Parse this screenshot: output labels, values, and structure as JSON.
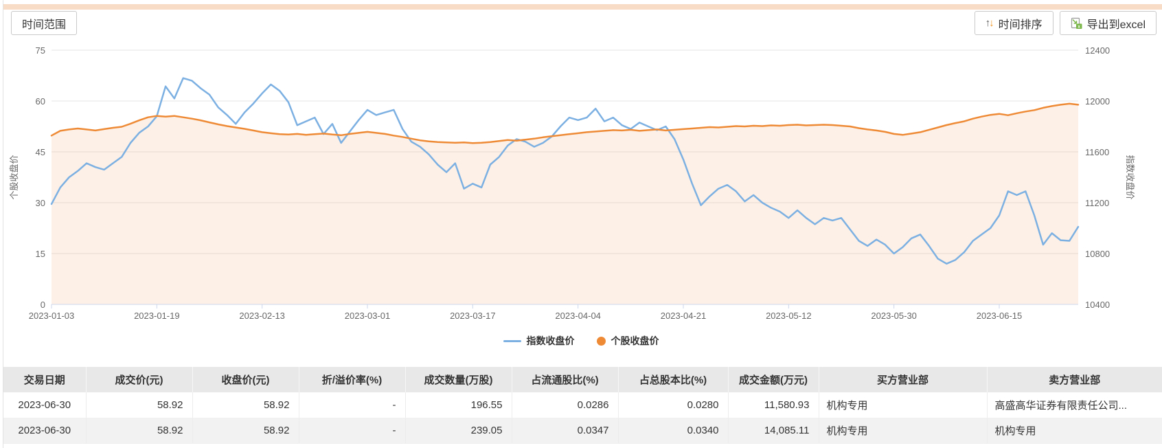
{
  "toolbar": {
    "time_range_label": "时间范围",
    "time_sort_label": "时间排序",
    "export_label": "导出到excel"
  },
  "colors": {
    "top_strip": "#f9dcc6",
    "index_line": "#7cb0e2",
    "stock_line": "#ee8a36",
    "area_fill": "rgba(238,150,70,0.13)",
    "grid": "#e6e6e6",
    "axis_line": "#ccd6eb",
    "axis_text": "#666666"
  },
  "chart_data": {
    "type": "line",
    "x_tick_every": 12,
    "x": [
      "2023-01-03",
      "2023-01-04",
      "2023-01-05",
      "2023-01-06",
      "2023-01-09",
      "2023-01-10",
      "2023-01-11",
      "2023-01-12",
      "2023-01-13",
      "2023-01-16",
      "2023-01-17",
      "2023-01-18",
      "2023-01-19",
      "2023-01-20",
      "2023-01-30",
      "2023-01-31",
      "2023-02-01",
      "2023-02-02",
      "2023-02-03",
      "2023-02-06",
      "2023-02-07",
      "2023-02-08",
      "2023-02-09",
      "2023-02-10",
      "2023-02-13",
      "2023-02-14",
      "2023-02-15",
      "2023-02-16",
      "2023-02-17",
      "2023-02-20",
      "2023-02-21",
      "2023-02-22",
      "2023-02-23",
      "2023-02-24",
      "2023-02-27",
      "2023-02-28",
      "2023-03-01",
      "2023-03-02",
      "2023-03-03",
      "2023-03-06",
      "2023-03-07",
      "2023-03-08",
      "2023-03-09",
      "2023-03-10",
      "2023-03-13",
      "2023-03-14",
      "2023-03-15",
      "2023-03-16",
      "2023-03-17",
      "2023-03-20",
      "2023-03-21",
      "2023-03-22",
      "2023-03-23",
      "2023-03-24",
      "2023-03-27",
      "2023-03-28",
      "2023-03-29",
      "2023-03-30",
      "2023-03-31",
      "2023-04-03",
      "2023-04-04",
      "2023-04-06",
      "2023-04-07",
      "2023-04-10",
      "2023-04-11",
      "2023-04-12",
      "2023-04-13",
      "2023-04-14",
      "2023-04-17",
      "2023-04-18",
      "2023-04-19",
      "2023-04-20",
      "2023-04-21",
      "2023-04-24",
      "2023-04-25",
      "2023-04-26",
      "2023-04-27",
      "2023-04-28",
      "2023-05-04",
      "2023-05-05",
      "2023-05-08",
      "2023-05-09",
      "2023-05-10",
      "2023-05-11",
      "2023-05-12",
      "2023-05-15",
      "2023-05-16",
      "2023-05-17",
      "2023-05-18",
      "2023-05-19",
      "2023-05-22",
      "2023-05-23",
      "2023-05-24",
      "2023-05-25",
      "2023-05-26",
      "2023-05-29",
      "2023-05-30",
      "2023-05-31",
      "2023-06-01",
      "2023-06-02",
      "2023-06-05",
      "2023-06-06",
      "2023-06-07",
      "2023-06-08",
      "2023-06-09",
      "2023-06-12",
      "2023-06-13",
      "2023-06-14",
      "2023-06-15",
      "2023-06-16",
      "2023-06-19",
      "2023-06-20",
      "2023-06-21",
      "2023-06-26",
      "2023-06-27",
      "2023-06-28",
      "2023-06-29",
      "2023-06-30"
    ],
    "series": [
      {
        "name": "指数收盘价",
        "axis": "right",
        "color": "#7cb0e2",
        "values": [
          11190,
          11320,
          11400,
          11450,
          11510,
          11480,
          11460,
          11510,
          11560,
          11670,
          11750,
          11800,
          11880,
          12115,
          12020,
          12180,
          12160,
          12100,
          12050,
          11950,
          11890,
          11820,
          11910,
          11980,
          12060,
          12130,
          12080,
          11990,
          11810,
          11840,
          11870,
          11740,
          11820,
          11670,
          11760,
          11850,
          11930,
          11890,
          11910,
          11930,
          11780,
          11680,
          11640,
          11580,
          11500,
          11440,
          11510,
          11310,
          11350,
          11320,
          11500,
          11560,
          11650,
          11700,
          11680,
          11640,
          11670,
          11720,
          11800,
          11870,
          11850,
          11870,
          11940,
          11840,
          11870,
          11810,
          11780,
          11830,
          11800,
          11770,
          11800,
          11700,
          11540,
          11350,
          11180,
          11250,
          11310,
          11340,
          11290,
          11210,
          11260,
          11200,
          11160,
          11130,
          11080,
          11140,
          11080,
          11030,
          11080,
          11060,
          11080,
          10990,
          10900,
          10860,
          10910,
          10870,
          10800,
          10850,
          10920,
          10950,
          10860,
          10760,
          10720,
          10750,
          10810,
          10900,
          10950,
          11000,
          11100,
          11290,
          11260,
          11290,
          11100,
          10870,
          10960,
          10905,
          10900,
          11010
        ]
      },
      {
        "name": "个股收盘价",
        "axis": "left",
        "color": "#ee8a36",
        "area_fill": "rgba(238,150,70,0.13)",
        "values": [
          49.8,
          51.2,
          51.6,
          51.9,
          51.6,
          51.3,
          51.7,
          52.1,
          52.4,
          53.3,
          54.3,
          55.2,
          55.6,
          55.4,
          55.6,
          55.2,
          54.8,
          54.3,
          53.7,
          53.1,
          52.6,
          52.2,
          51.8,
          51.3,
          50.8,
          50.5,
          50.2,
          50.1,
          50.3,
          50.0,
          50.2,
          50.4,
          50.1,
          49.9,
          50.3,
          50.6,
          50.9,
          50.6,
          50.3,
          49.8,
          49.4,
          48.9,
          48.4,
          48.1,
          47.9,
          47.8,
          47.7,
          47.8,
          47.6,
          47.7,
          47.9,
          48.2,
          48.5,
          48.3,
          48.6,
          48.9,
          49.3,
          49.6,
          49.9,
          50.2,
          50.5,
          50.8,
          51.0,
          51.2,
          51.4,
          51.3,
          51.5,
          51.2,
          51.4,
          51.6,
          51.3,
          51.5,
          51.7,
          51.9,
          52.1,
          52.3,
          52.2,
          52.4,
          52.6,
          52.5,
          52.7,
          52.6,
          52.8,
          52.7,
          52.9,
          53.0,
          52.8,
          52.9,
          53.0,
          52.9,
          52.7,
          52.5,
          52.0,
          51.6,
          51.3,
          50.9,
          50.3,
          50.0,
          50.4,
          50.8,
          51.5,
          52.2,
          52.9,
          53.5,
          54.0,
          54.8,
          55.4,
          55.9,
          56.2,
          55.8,
          56.4,
          56.9,
          57.3,
          58.0,
          58.5,
          58.9,
          59.2,
          58.9
        ]
      }
    ],
    "left_axis": {
      "title": "个股收盘价",
      "min": 0,
      "max": 75,
      "ticks": [
        0,
        15,
        30,
        45,
        60,
        75
      ]
    },
    "right_axis": {
      "title": "指数收盘价",
      "min": 10400,
      "max": 12400,
      "ticks": [
        10400,
        10800,
        11200,
        11600,
        12000,
        12400
      ]
    },
    "legend": [
      {
        "label": "指数收盘价",
        "marker": "line",
        "color": "#7cb0e2"
      },
      {
        "label": "个股收盘价",
        "marker": "circle",
        "color": "#ee8a36"
      }
    ],
    "grid": true,
    "legend_position": "bottom"
  },
  "table": {
    "headers": [
      "交易日期",
      "成交价(元)",
      "收盘价(元)",
      "折/溢价率(%)",
      "成交数量(万股)",
      "占流通股比(%)",
      "占总股本比(%)",
      "成交金额(万元)",
      "买方营业部",
      "卖方营业部"
    ],
    "align": [
      "center",
      "right",
      "right",
      "right",
      "right",
      "right",
      "right",
      "right",
      "left",
      "left"
    ],
    "rows": [
      [
        "2023-06-30",
        "58.92",
        "58.92",
        "-",
        "196.55",
        "0.0286",
        "0.0280",
        "11,580.93",
        "机构专用",
        "高盛高华证券有限责任公司..."
      ],
      [
        "2023-06-30",
        "58.92",
        "58.92",
        "-",
        "239.05",
        "0.0347",
        "0.0340",
        "14,085.11",
        "机构专用",
        "机构专用"
      ]
    ]
  }
}
